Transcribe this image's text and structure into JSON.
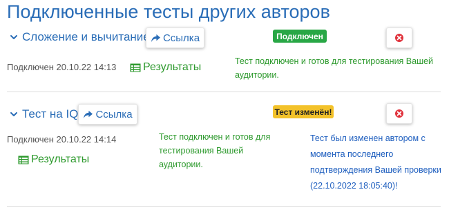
{
  "page": {
    "title": "Подключенные тесты других авторов"
  },
  "tests": [
    {
      "name": "Сложение и вычитание",
      "link_label": "Ссылка",
      "status_badge": "Подключен",
      "connected_at": "Подключен 20.10.22 14:13",
      "results_label": "Результаты",
      "status_note": "Тест подключен и готов для тестирования Вашей аудитории."
    },
    {
      "name": "Тест на IQ",
      "link_label": "Ссылка",
      "status_badge": "Тест изменён!",
      "connected_at": "Подключен 20.10.22 14:14",
      "results_label": "Результаты",
      "status_note": "Тест подключен и готов для тестирования Вашей аудитории.",
      "change_note": "Тест был изменен автором с момента последнего подтверждения Вашей проверки (22.10.2022 18:05:40)!"
    }
  ],
  "colors": {
    "title_blue": "#2a6db7",
    "success_green": "#28a745",
    "text_green": "#2e9a2e",
    "warning_yellow": "#f3c22a",
    "delete_red": "#e0323c",
    "note_blue": "#1f5fbf"
  },
  "icons": {
    "expand": "chevron-down-icon",
    "link": "share-arrow-icon",
    "results": "table-icon",
    "delete": "remove-circle-icon"
  }
}
